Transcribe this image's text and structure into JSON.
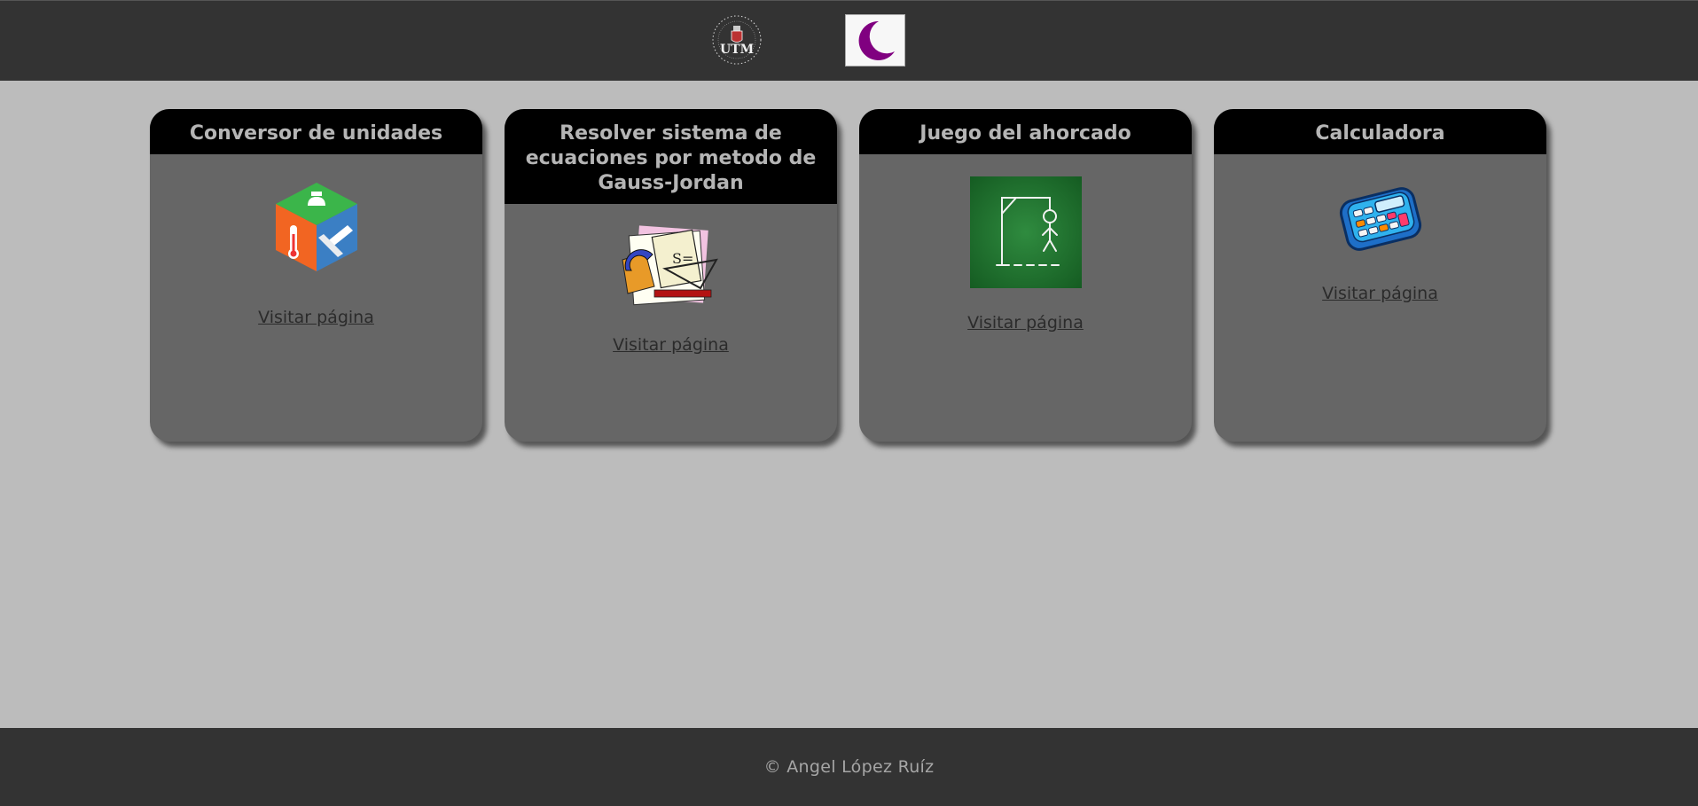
{
  "header": {
    "logo_label": "UTM",
    "theme_toggle_icon": "moon-icon",
    "theme_toggle_color": "#800080"
  },
  "cards": [
    {
      "title": "Conversor de unidades",
      "icon": "unit-converter-cube-icon",
      "link_label": "Visitar página"
    },
    {
      "title": "Resolver sistema de ecuaciones por metodo de Gauss-Jordan",
      "icon": "math-geometry-tools-icon",
      "link_label": "Visitar página"
    },
    {
      "title": "Juego del ahorcado",
      "icon": "hangman-chalkboard-icon",
      "link_label": "Visitar página"
    },
    {
      "title": "Calculadora",
      "icon": "calculator-icon",
      "link_label": "Visitar página"
    }
  ],
  "footer": {
    "text": "© Angel López Ruíz"
  },
  "colors": {
    "page_background": "#bcbcbc",
    "bar_background": "#333333",
    "card_background": "#666666",
    "card_header": "#000000"
  }
}
